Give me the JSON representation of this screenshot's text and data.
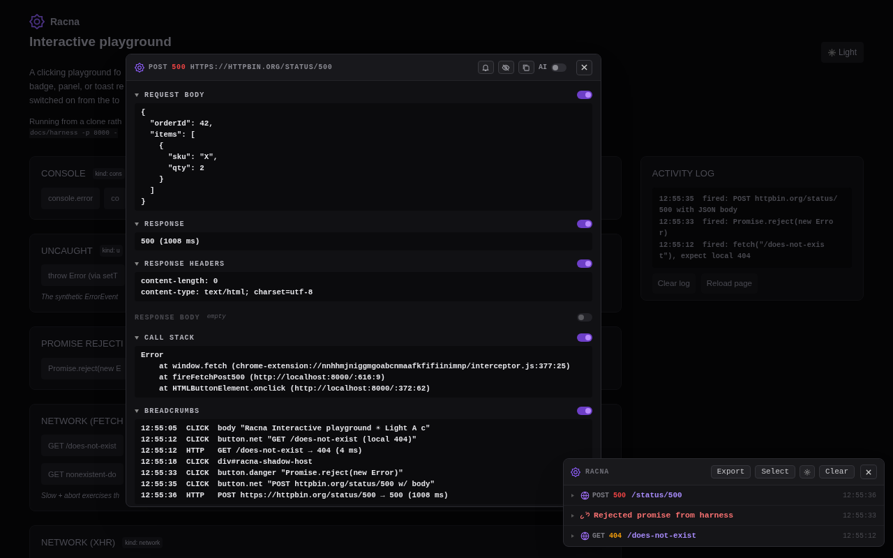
{
  "page": {
    "brand": "Racna",
    "title": "Interactive playground",
    "theme_button": "Light",
    "intro_lines": [
      "A clicking playground fo",
      "badge, panel, or toast re",
      "switched on from the to"
    ],
    "run_line": "Running from a clone rath",
    "run_code": "docs/harness -p 8000 -",
    "cards": [
      {
        "title": "CONSOLE",
        "badge": "kind: cons",
        "button_rows": [
          [
            "console.error",
            "co"
          ]
        ]
      },
      {
        "title": "UNCAUGHT",
        "badge": "kind: u",
        "button_rows": [
          [
            "throw Error (via setT"
          ]
        ],
        "note": "The synthetic ErrorEvent"
      },
      {
        "title": "PROMISE REJECTI",
        "button_rows": [
          [
            "Promise.reject(new E"
          ]
        ]
      },
      {
        "title": "NETWORK (FETCH",
        "button_rows": [
          [
            "GET /does-not-exist"
          ],
          [
            "GET nonexistent-do"
          ]
        ],
        "note": "Slow + abort exercises th"
      },
      {
        "title": "NETWORK (XHR)",
        "badge": "kind: network"
      }
    ],
    "activity": {
      "title": "ACTIVITY LOG",
      "entries": [
        "12:55:35  fired: POST httpbin.org/status/500 with JSON body",
        "12:55:33  fired: Promise.reject(new Error)",
        "12:55:12  fired: fetch(\"/does-not-exist\"), expect local 404"
      ],
      "buttons": [
        "Clear log",
        "Reload page"
      ]
    }
  },
  "detail": {
    "method": "POST",
    "status": "500",
    "url": "HTTPS://HTTPBIN.ORG/STATUS/500",
    "ai_label": "AI",
    "ai_on": false,
    "sections": [
      {
        "kind": "code",
        "title": "REQUEST BODY",
        "expanded": true,
        "on": true,
        "lines": [
          "{",
          "  \"orderId\": 42,",
          "  \"items\": [",
          "    {",
          "      \"sku\": \"X\",",
          "      \"qty\": 2",
          "    }",
          "  ]",
          "}"
        ]
      },
      {
        "kind": "code",
        "title": "RESPONSE",
        "expanded": true,
        "on": true,
        "lines": [
          "500 (1008 ms)"
        ]
      },
      {
        "kind": "code",
        "title": "RESPONSE HEADERS",
        "expanded": true,
        "on": true,
        "lines": [
          "content-length: 0",
          "content-type: text/html; charset=utf-8"
        ]
      },
      {
        "kind": "code",
        "title": "RESPONSE BODY",
        "expanded": false,
        "on": false,
        "note": "empty"
      },
      {
        "kind": "code",
        "title": "CALL STACK",
        "expanded": true,
        "on": true,
        "lines": [
          "Error",
          "    at window.fetch (chrome-extension://nnhhmjniggmgoabcnmaafkfifiinimnp/interceptor.js:377:25)",
          "    at fireFetchPost500 (http://localhost:8000/:616:9)",
          "    at HTMLButtonElement.onclick (http://localhost:8000/:372:62)"
        ]
      },
      {
        "kind": "crumbs",
        "title": "BREADCRUMBS",
        "expanded": true,
        "on": true,
        "crumbs": [
          {
            "time": "12:55:05",
            "type": "CLICK",
            "text": "body \"Racna Interactive playground ☀ Light A c\""
          },
          {
            "time": "12:55:12",
            "type": "CLICK",
            "text": "button.net \"GET /does-not-exist (local 404)\""
          },
          {
            "time": "12:55:12",
            "type": "HTTP",
            "text": "GET /does-not-exist → 404 (4 ms)"
          },
          {
            "time": "12:55:18",
            "type": "CLICK",
            "text": "div#racna-shadow-host"
          },
          {
            "time": "12:55:33",
            "type": "CLICK",
            "text": "button.danger \"Promise.reject(new Error)\""
          },
          {
            "time": "12:55:35",
            "type": "CLICK",
            "text": "button.net \"POST httpbin.org/status/500 w/ body\""
          },
          {
            "time": "12:55:36",
            "type": "HTTP",
            "text": "POST https://httpbin.org/status/500 → 500 (1008 ms)"
          }
        ]
      }
    ]
  },
  "panel": {
    "title": "RACNA",
    "buttons": [
      "Export",
      "Select"
    ],
    "clear": "Clear",
    "events": [
      {
        "kind": "network",
        "method": "POST",
        "status": "500",
        "color": "#ef4444",
        "path": "/status/500",
        "time": "12:55:36"
      },
      {
        "kind": "promise",
        "message": "Rejected promise from harness",
        "time": "12:55:33"
      },
      {
        "kind": "network",
        "method": "GET",
        "status": "404",
        "color": "#f59e0b",
        "path": "/does-not-exist",
        "time": "12:55:12"
      }
    ]
  }
}
